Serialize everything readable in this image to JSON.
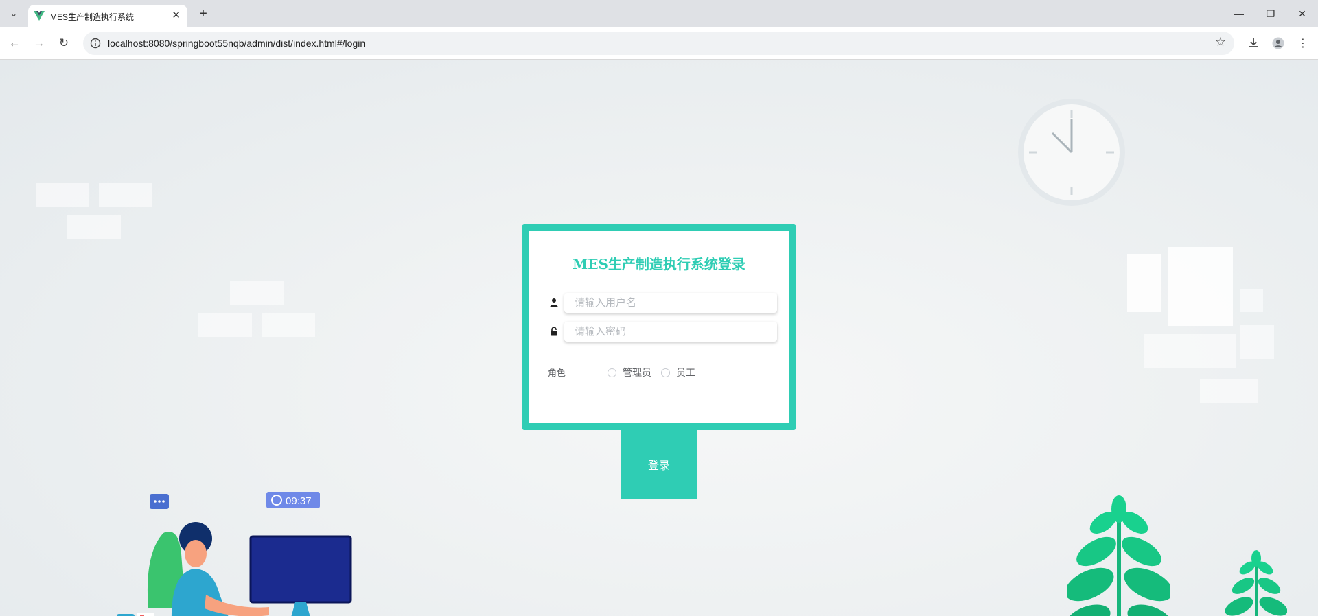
{
  "browser": {
    "tab_title": "MES生产制造执行系统",
    "url": "localhost:8080/springboot55nqb/admin/dist/index.html#/login"
  },
  "login": {
    "title": "MES生产制造执行系统登录",
    "username_placeholder": "请输入用户名",
    "password_placeholder": "请输入密码",
    "role_label": "角色",
    "roles": [
      "管理员",
      "员工"
    ],
    "submit_label": "登录"
  },
  "illustration": {
    "clock_time": "09:37"
  },
  "colors": {
    "accent": "#2fcdb4",
    "placeholder": "#b4b8bd",
    "plant": "#19d18e"
  }
}
